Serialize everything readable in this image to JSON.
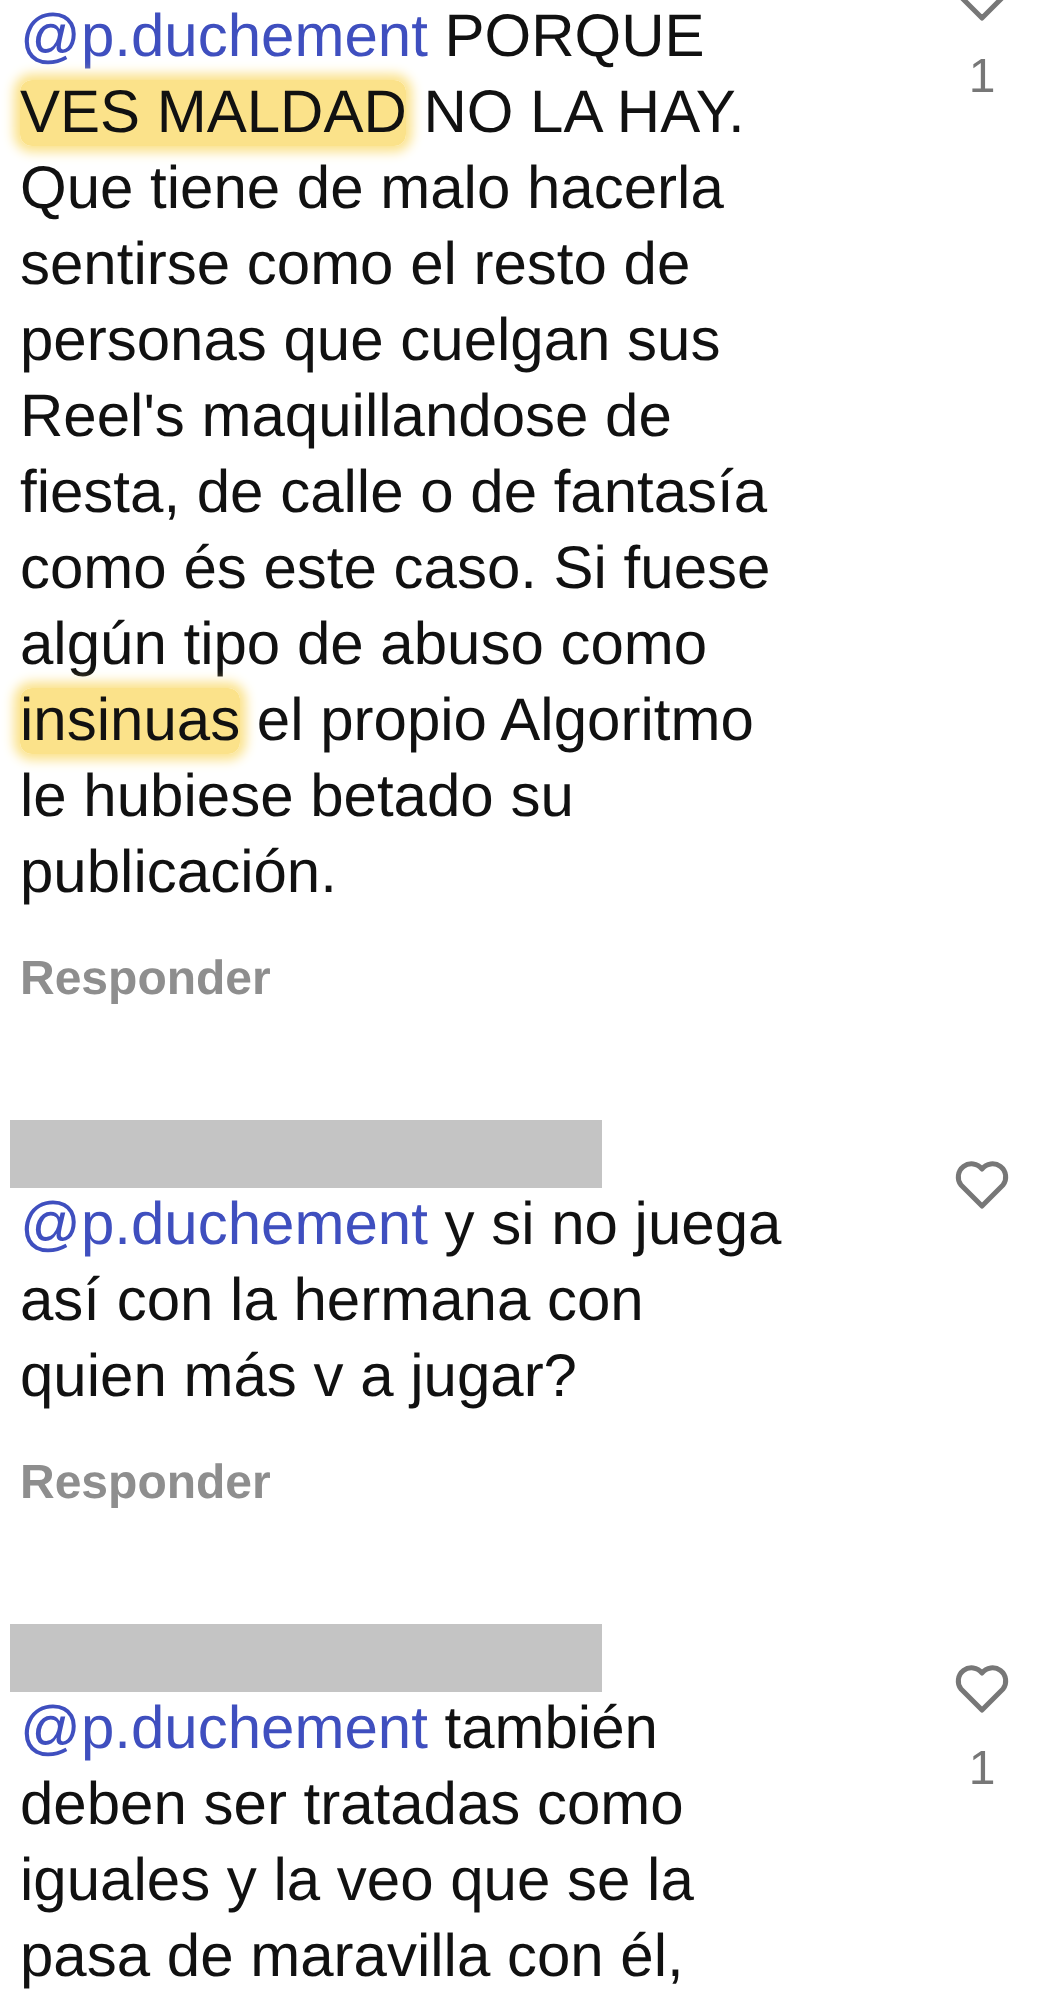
{
  "comments": [
    {
      "segments": [
        {
          "kind": "mention",
          "text": "@p.duchement"
        },
        {
          "kind": "plain",
          "text": " PORQUE\n"
        },
        {
          "kind": "highlight",
          "text": "VES MALDAD"
        },
        {
          "kind": "plain",
          "text": " NO LA HAY.\nQue tiene de malo hacerla\nsentirse como el resto de\npersonas que cuelgan sus\nReel's maquillandose de\nfiesta, de calle o de fantasía\ncomo és este caso. Si fuese\nalgún tipo de abuso como\n"
        },
        {
          "kind": "highlight",
          "text": "insinuas"
        },
        {
          "kind": "plain",
          "text": " el propio Algoritmo\nle hubiese betado su\npublicación."
        }
      ],
      "likes": "1",
      "reply": "Responder"
    },
    {
      "username_redacted": true,
      "segments": [
        {
          "kind": "mention",
          "text": "@p.duchement"
        },
        {
          "kind": "plain",
          "text": " y si no juega\nasí con la hermana con\nquien más v a jugar?"
        }
      ],
      "reply": "Responder"
    },
    {
      "username_redacted": true,
      "segments": [
        {
          "kind": "mention",
          "text": "@p.duchement"
        },
        {
          "kind": "plain",
          "text": " también\ndeben ser tratadas como\niguales y la veo que se la\npasa de maravilla con él,"
        }
      ],
      "likes": "1"
    }
  ]
}
